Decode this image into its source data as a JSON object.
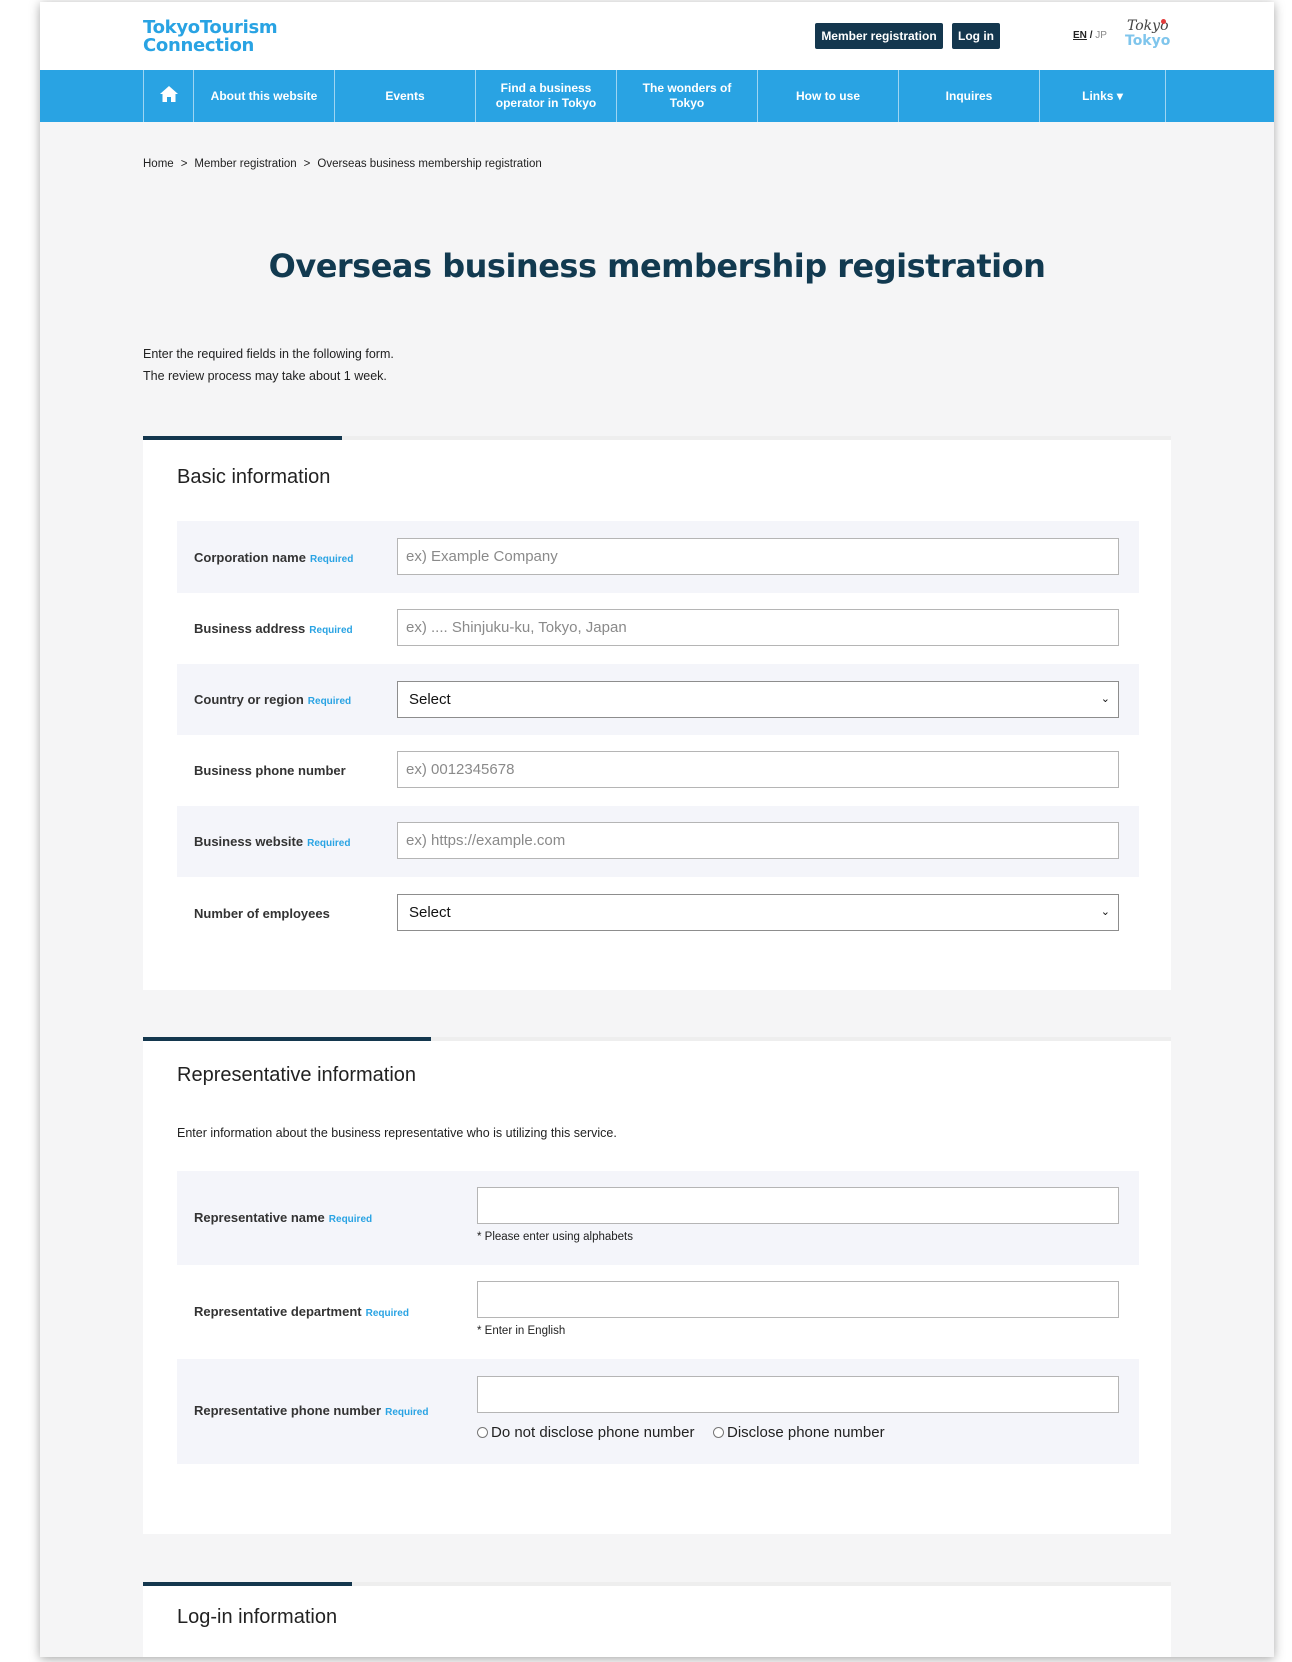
{
  "header": {
    "logo_line1": "TokyoTourism",
    "logo_line2": "Connection",
    "member_registration": "Member registration",
    "login": "Log in",
    "lang_en": "EN",
    "lang_sep": "/",
    "lang_jp": "JP",
    "brand_line1": "Tokyo",
    "brand_line2": "Tokyo"
  },
  "nav": {
    "home_icon": "home-icon",
    "items": [
      "About this website",
      "Events",
      "Find a business operator in Tokyo",
      "The wonders of Tokyo",
      "How to use",
      "Inquires",
      "Links ▾"
    ]
  },
  "breadcrumb": {
    "items": [
      "Home",
      "Member registration",
      "Overseas business membership registration"
    ],
    "separator": ">"
  },
  "page": {
    "title": "Overseas business membership registration",
    "intro_line1": "Enter the required fields in the following form.",
    "intro_line2": "The review process may take about 1 week."
  },
  "required_label": "Required",
  "basic": {
    "title": "Basic information",
    "fields": {
      "corporation_name": {
        "label": "Corporation name",
        "placeholder": "ex) Example Company"
      },
      "business_address": {
        "label": "Business address",
        "placeholder": "ex) .... Shinjuku-ku, Tokyo, Japan"
      },
      "country": {
        "label": "Country or region",
        "value": "Select"
      },
      "phone": {
        "label": "Business phone number",
        "placeholder": "ex) 0012345678"
      },
      "website": {
        "label": "Business website",
        "placeholder": "ex) https://example.com"
      },
      "employees": {
        "label": "Number of employees",
        "value": "Select"
      }
    }
  },
  "representative": {
    "title": "Representative information",
    "description": "Enter information about the business representative who is utilizing this service.",
    "fields": {
      "name": {
        "label": "Representative name",
        "hint": "* Please enter using alphabets",
        "value": ""
      },
      "department": {
        "label": "Representative department",
        "hint": "* Enter in English",
        "value": ""
      },
      "phone": {
        "label": "Representative phone number",
        "value": "",
        "radio_no": "Do not disclose phone number",
        "radio_yes": "Disclose phone number"
      }
    }
  },
  "login_section": {
    "title": "Log-in information"
  },
  "colors": {
    "brand_blue": "#29a3e3",
    "navy": "#14374e",
    "title_navy": "#123a50",
    "row_shade": "#f4f5fa"
  }
}
